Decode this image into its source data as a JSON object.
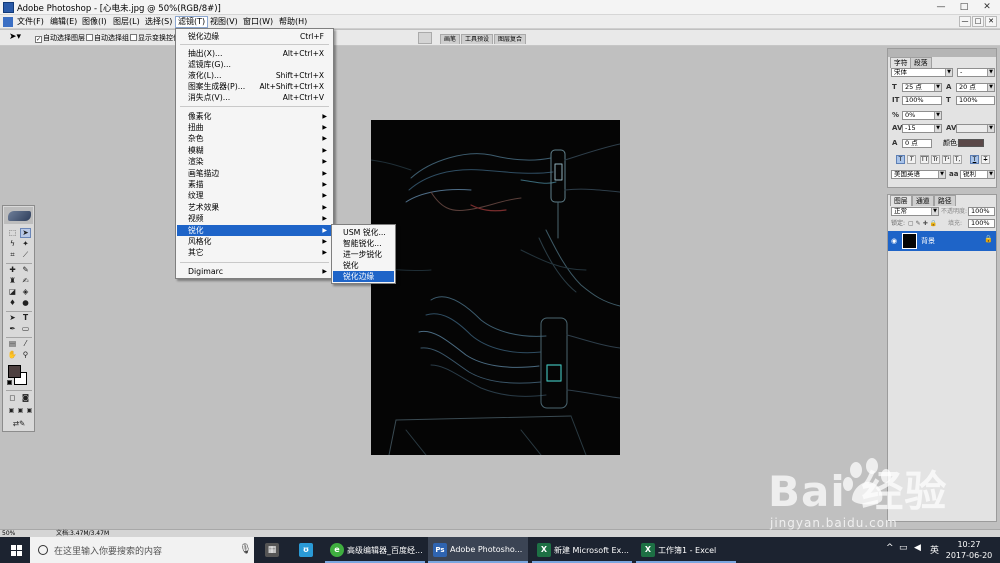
{
  "title_bar": {
    "title": "Adobe Photoshop - [心电未.jpg @ 50%(RGB/8#)]",
    "min": "—",
    "max": "□",
    "close": "✕"
  },
  "menu_bar": {
    "items": [
      "文件(F)",
      "编辑(E)",
      "图像(I)",
      "图层(L)",
      "选择(S)",
      "滤镜(T)",
      "视图(V)",
      "窗口(W)",
      "帮助(H)"
    ],
    "active_index": 5
  },
  "options_bar": {
    "auto_select_layer": "自动选择图层",
    "auto_select_group": "自动选择组",
    "show_transform": "显示变换控件",
    "well_tabs": [
      "画笔",
      "工具预设",
      "图层复合"
    ]
  },
  "filter_menu": {
    "last_filter": {
      "label": "锐化边缘",
      "shortcut": "Ctrl+F"
    },
    "group1": [
      {
        "label": "抽出(X)...",
        "shortcut": "Alt+Ctrl+X"
      },
      {
        "label": "滤镜库(G)...",
        "shortcut": ""
      },
      {
        "label": "液化(L)...",
        "shortcut": "Shift+Ctrl+X"
      },
      {
        "label": "图案生成器(P)...",
        "shortcut": "Alt+Shift+Ctrl+X"
      },
      {
        "label": "消失点(V)...",
        "shortcut": "Alt+Ctrl+V"
      }
    ],
    "group2": [
      "像素化",
      "扭曲",
      "杂色",
      "模糊",
      "渲染",
      "画笔描边",
      "素描",
      "纹理",
      "艺术效果",
      "视频",
      "锐化",
      "风格化",
      "其它"
    ],
    "highlighted": "锐化",
    "group3": [
      "Digimarc"
    ]
  },
  "sharpen_submenu": {
    "items": [
      "USM 锐化...",
      "智能锐化...",
      "进一步锐化",
      "锐化",
      "锐化边缘"
    ],
    "highlighted": "锐化边缘"
  },
  "character_panel": {
    "tabs": [
      "字符",
      "段落"
    ],
    "font_family": "宋体",
    "font_style": "-",
    "font_size": "25 点",
    "leading": "20 点",
    "vertical_scale": "100%",
    "horizontal_scale": "100%",
    "tracking": "0%",
    "kerning": "-15",
    "baseline_shift": "0 点",
    "color_label": "颜色:",
    "text_color": "#5a4848",
    "language": "美国英语",
    "aa_icon": "aa",
    "anti_alias": "锐利",
    "style_buttons": [
      "T",
      "T",
      "TT",
      "Tr",
      "T¹",
      "T,",
      "T",
      "T"
    ]
  },
  "layers_panel": {
    "tabs": [
      "图层",
      "通道",
      "路径"
    ],
    "blend_mode": "正常",
    "opacity_label": "不透明度:",
    "opacity": "100%",
    "lock_label": "锁定:",
    "fill_label": "填充:",
    "fill": "100%",
    "layer_name": "背景"
  },
  "status_bar": {
    "zoom": "50%",
    "doc_size": "文档:3.47M/3.47M"
  },
  "taskbar": {
    "search_placeholder": "在这里输入你要搜索的内容",
    "apps": [
      {
        "label": "高级编辑器_百度经...",
        "icon": "e",
        "color": "#3fae3f"
      },
      {
        "label": "Adobe Photosho...",
        "icon": "Ps",
        "color": "#2f64b0"
      },
      {
        "label": "新建 Microsoft Ex...",
        "icon": "X",
        "color": "#1d7044"
      },
      {
        "label": "工作簿1 - Excel",
        "icon": "X",
        "color": "#1d7044"
      }
    ],
    "ime": "英",
    "time": "10:27",
    "date": "2017-06-20"
  },
  "watermark": {
    "text": "Bai 经验",
    "url": "jingyan.baidu.com"
  },
  "colors": {
    "menu_highlight": "#1e64c8",
    "foreground": "#4d4040",
    "background": "#ffffff",
    "workspace": "#c0c0c0"
  }
}
